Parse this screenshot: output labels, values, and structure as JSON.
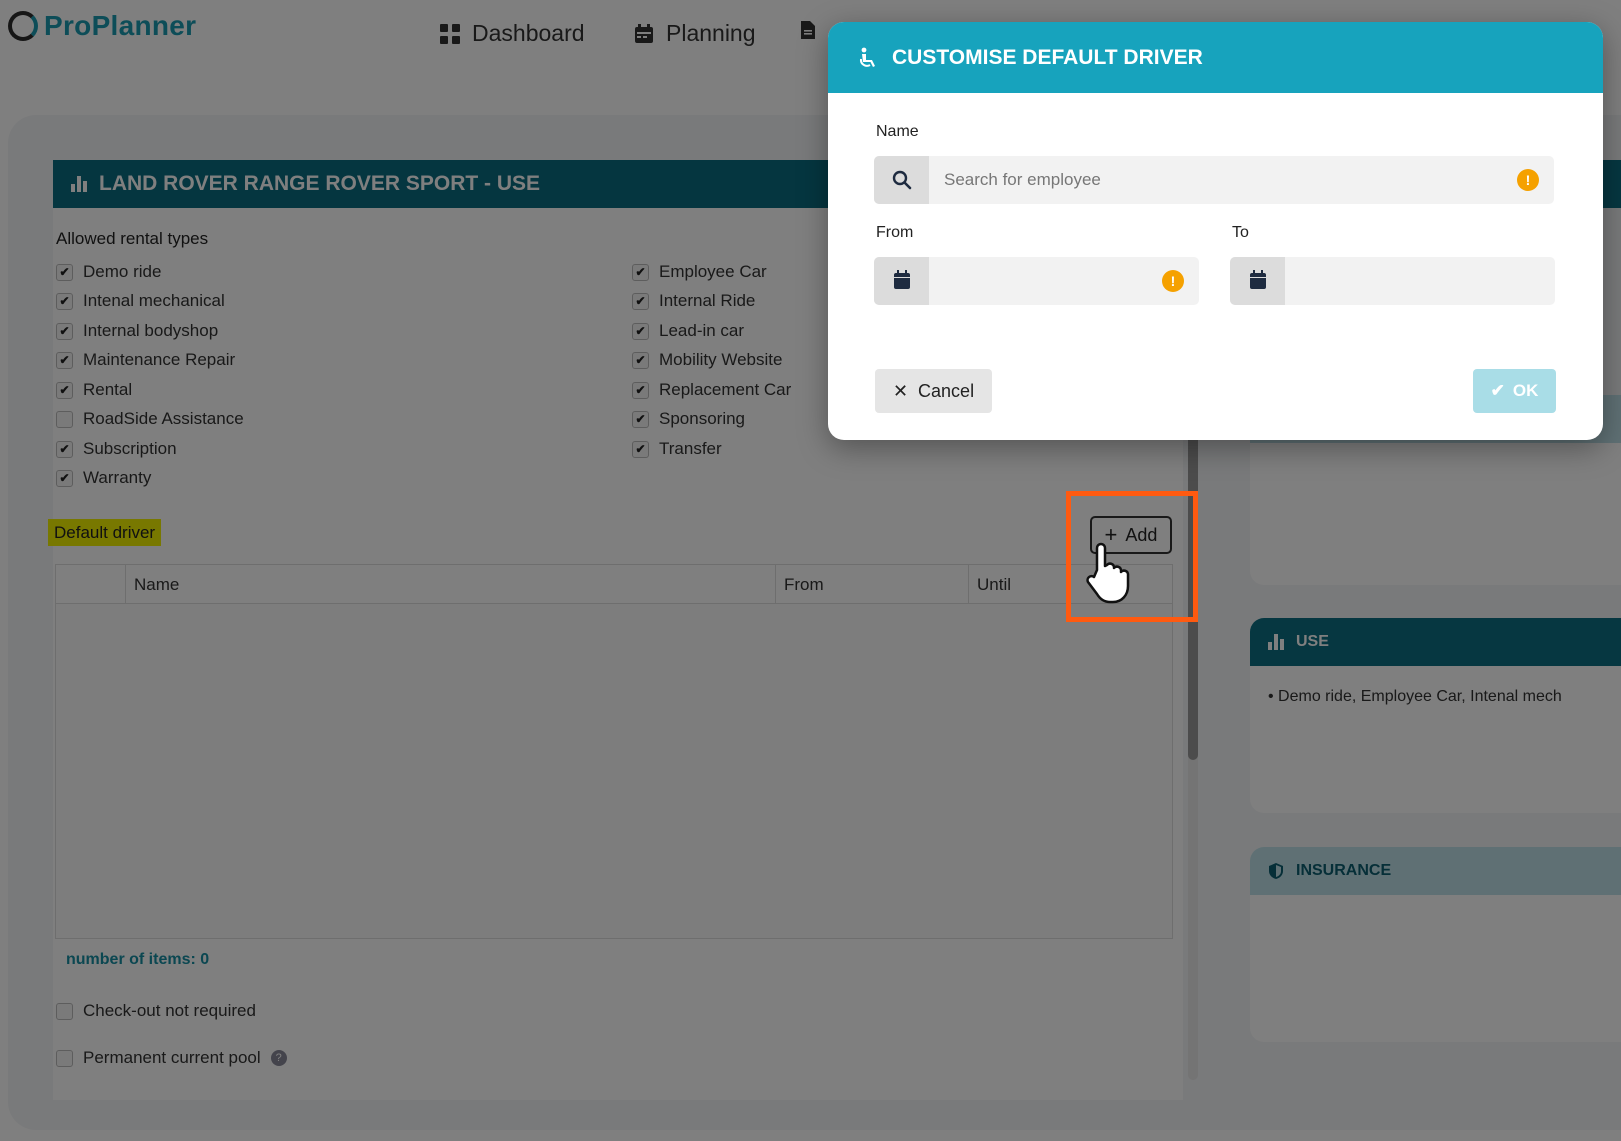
{
  "app": {
    "name": "ProPlanner"
  },
  "nav": [
    {
      "label": "Dashboard",
      "icon": "dashboard-grid-icon"
    },
    {
      "label": "Planning",
      "icon": "calendar-icon"
    },
    {
      "label": "",
      "icon": "document-icon"
    }
  ],
  "panel": {
    "title": "LAND ROVER RANGE ROVER SPORT - USE",
    "allowed_label": "Allowed rental types",
    "rental_types_left": [
      {
        "label": "Demo ride",
        "checked": true
      },
      {
        "label": "Intenal mechanical",
        "checked": true
      },
      {
        "label": "Internal bodyshop",
        "checked": true
      },
      {
        "label": "Maintenance Repair",
        "checked": true
      },
      {
        "label": "Rental",
        "checked": true
      },
      {
        "label": "RoadSide Assistance",
        "checked": false
      },
      {
        "label": "Subscription",
        "checked": true
      },
      {
        "label": "Warranty",
        "checked": true
      }
    ],
    "rental_types_right": [
      {
        "label": "Employee Car",
        "checked": true
      },
      {
        "label": "Internal Ride",
        "checked": true
      },
      {
        "label": "Lead-in car",
        "checked": true
      },
      {
        "label": "Mobility Website",
        "checked": true
      },
      {
        "label": "Replacement Car",
        "checked": true
      },
      {
        "label": "Sponsoring",
        "checked": true
      },
      {
        "label": "Transfer",
        "checked": true
      }
    ],
    "default_driver_label": "Default driver",
    "add_label": "Add",
    "table_headers": [
      "Name",
      "From",
      "Until"
    ],
    "count_label": "number of items: 0",
    "checkout_label": "Check-out not required",
    "pool_label": "Permanent current pool"
  },
  "right_cards": {
    "use_title": "USE",
    "use_text": "Demo ride, Employee Car, Intenal mech",
    "insurance_title": "INSURANCE"
  },
  "modal": {
    "title": "CUSTOMISE DEFAULT DRIVER",
    "name_label": "Name",
    "name_placeholder": "Search for employee",
    "from_label": "From",
    "to_label": "To",
    "cancel_label": "Cancel",
    "ok_label": "OK"
  },
  "colors": {
    "brand": "#1a9bb0",
    "header_dark": "#0a6c80",
    "modal_header": "#17a3bd",
    "warning": "#f5a100",
    "highlight_box": "#ff5a10",
    "highlight_text": "#f1f000"
  }
}
